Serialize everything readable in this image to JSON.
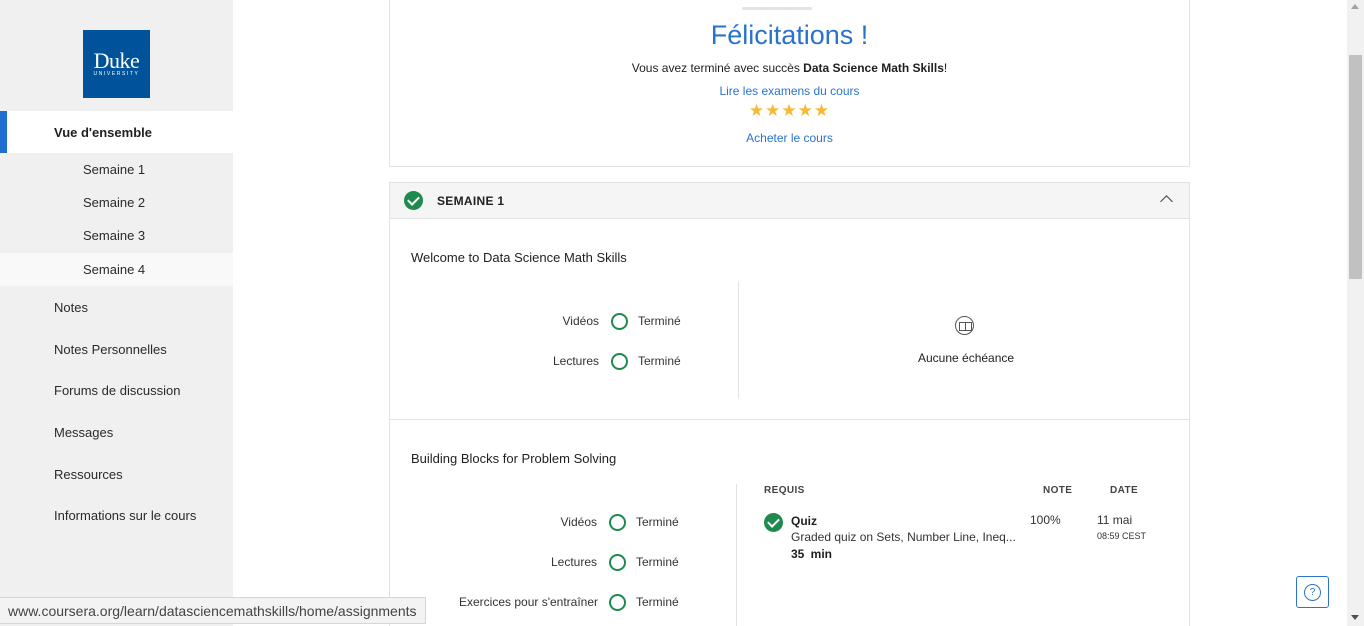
{
  "logo": {
    "name": "Duke",
    "sub": "UNIVERSITY"
  },
  "sidebar": {
    "overview": "Vue d'ensemble",
    "weeks": [
      "Semaine 1",
      "Semaine 2",
      "Semaine 3",
      "Semaine 4"
    ],
    "items": [
      "Notes",
      "Notes Personnelles",
      "Forums de discussion",
      "Messages",
      "Ressources",
      "Informations sur le cours"
    ]
  },
  "status_url": "www.coursera.org/learn/datasciencemathskills/home/assignments",
  "completion": {
    "title": "Félicitations !",
    "message_prefix": "Vous avez terminé avec succès ",
    "course_name": "Data Science Math Skills",
    "message_suffix": "!",
    "reviews_link": "Lire les examens du cours",
    "rating_stars": 5,
    "stars": "★★★★★",
    "buy_link": "Acheter le cours"
  },
  "week": {
    "title": "SEMAINE 1",
    "sections": [
      {
        "title": "Welcome to Data Science Math Skills",
        "progress": [
          {
            "label": "Vidéos",
            "status": "Terminé"
          },
          {
            "label": "Lectures",
            "status": "Terminé"
          }
        ],
        "deadline": "Aucune échéance"
      },
      {
        "title": "Building Blocks for Problem Solving",
        "progress": [
          {
            "label": "Vidéos",
            "status": "Terminé"
          },
          {
            "label": "Lectures",
            "status": "Terminé"
          },
          {
            "label": "Exercices pour s'entraîner",
            "status": "Terminé"
          }
        ],
        "table": {
          "headers": {
            "required": "REQUIS",
            "grade": "NOTE",
            "date": "DATE"
          },
          "rows": [
            {
              "name": "Quiz",
              "description": "Graded quiz on Sets, Number Line, Ineq...",
              "duration": "35 min",
              "grade": "100%",
              "date": "11 mai",
              "time": "08:59 CEST"
            }
          ]
        }
      }
    ]
  },
  "colors": {
    "accent": "#2a73cc",
    "success": "#1e8a4e",
    "star": "#f5b934",
    "brand": "#00539b"
  }
}
